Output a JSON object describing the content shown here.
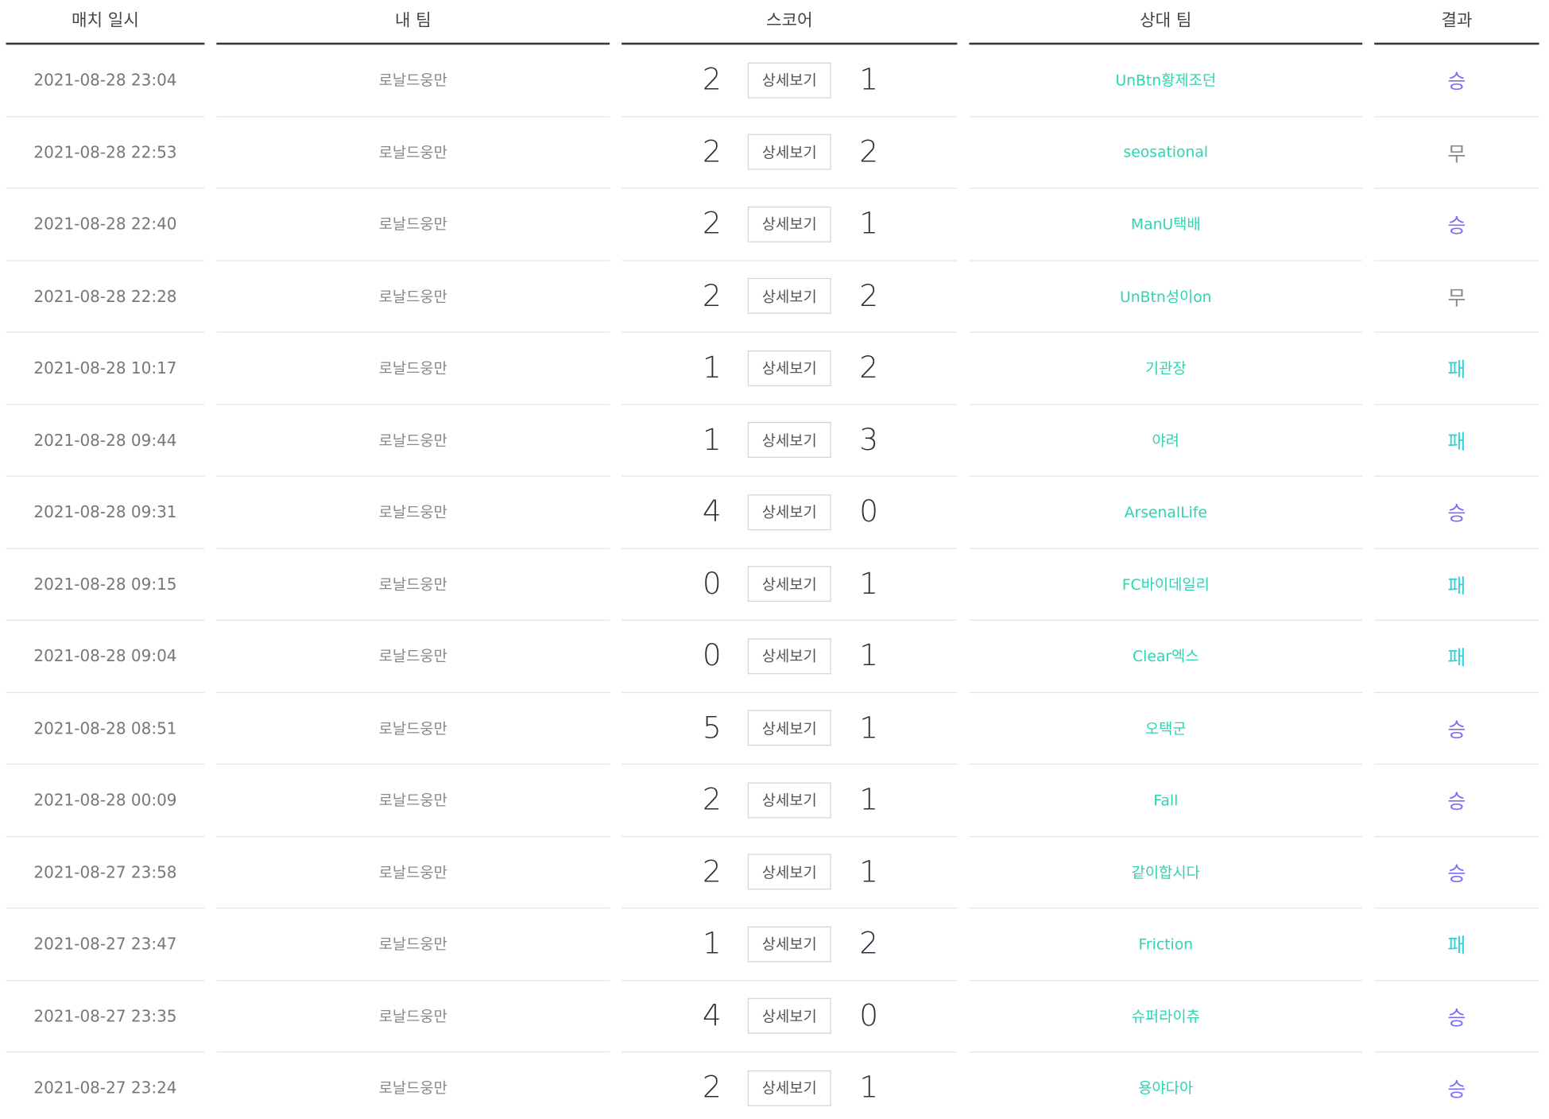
{
  "headers": {
    "date": "매치 일시",
    "my_team": "내 팀",
    "score": "스코어",
    "opponent": "상대 팀",
    "result": "결과"
  },
  "detail_label": "상세보기",
  "colors": {
    "win": "#7b6cf6",
    "draw": "#8a8a8a",
    "loss": "#33d1d3",
    "opponent": "#2fd3b0"
  },
  "matches": [
    {
      "date": "2021-08-28 23:04",
      "my_team": "로날드웅만",
      "my_score": "2",
      "opp_score": "1",
      "opponent": "UnBtn황제조던",
      "result": "승",
      "result_type": "win"
    },
    {
      "date": "2021-08-28 22:53",
      "my_team": "로날드웅만",
      "my_score": "2",
      "opp_score": "2",
      "opponent": "seosational",
      "result": "무",
      "result_type": "draw"
    },
    {
      "date": "2021-08-28 22:40",
      "my_team": "로날드웅만",
      "my_score": "2",
      "opp_score": "1",
      "opponent": "ManU택배",
      "result": "승",
      "result_type": "win"
    },
    {
      "date": "2021-08-28 22:28",
      "my_team": "로날드웅만",
      "my_score": "2",
      "opp_score": "2",
      "opponent": "UnBtn성이on",
      "result": "무",
      "result_type": "draw"
    },
    {
      "date": "2021-08-28 10:17",
      "my_team": "로날드웅만",
      "my_score": "1",
      "opp_score": "2",
      "opponent": "기관장",
      "result": "패",
      "result_type": "loss"
    },
    {
      "date": "2021-08-28 09:44",
      "my_team": "로날드웅만",
      "my_score": "1",
      "opp_score": "3",
      "opponent": "야려",
      "result": "패",
      "result_type": "loss"
    },
    {
      "date": "2021-08-28 09:31",
      "my_team": "로날드웅만",
      "my_score": "4",
      "opp_score": "0",
      "opponent": "ArsenalLife",
      "result": "승",
      "result_type": "win"
    },
    {
      "date": "2021-08-28 09:15",
      "my_team": "로날드웅만",
      "my_score": "0",
      "opp_score": "1",
      "opponent": "FC바이데일리",
      "result": "패",
      "result_type": "loss"
    },
    {
      "date": "2021-08-28 09:04",
      "my_team": "로날드웅만",
      "my_score": "0",
      "opp_score": "1",
      "opponent": "Clear엑스",
      "result": "패",
      "result_type": "loss"
    },
    {
      "date": "2021-08-28 08:51",
      "my_team": "로날드웅만",
      "my_score": "5",
      "opp_score": "1",
      "opponent": "오택군",
      "result": "승",
      "result_type": "win"
    },
    {
      "date": "2021-08-28 00:09",
      "my_team": "로날드웅만",
      "my_score": "2",
      "opp_score": "1",
      "opponent": "Fall",
      "result": "승",
      "result_type": "win"
    },
    {
      "date": "2021-08-27 23:58",
      "my_team": "로날드웅만",
      "my_score": "2",
      "opp_score": "1",
      "opponent": "같이합시다",
      "result": "승",
      "result_type": "win"
    },
    {
      "date": "2021-08-27 23:47",
      "my_team": "로날드웅만",
      "my_score": "1",
      "opp_score": "2",
      "opponent": "Friction",
      "result": "패",
      "result_type": "loss"
    },
    {
      "date": "2021-08-27 23:35",
      "my_team": "로날드웅만",
      "my_score": "4",
      "opp_score": "0",
      "opponent": "슈퍼라이츄",
      "result": "승",
      "result_type": "win"
    },
    {
      "date": "2021-08-27 23:24",
      "my_team": "로날드웅만",
      "my_score": "2",
      "opp_score": "1",
      "opponent": "용야다아",
      "result": "승",
      "result_type": "win"
    }
  ]
}
